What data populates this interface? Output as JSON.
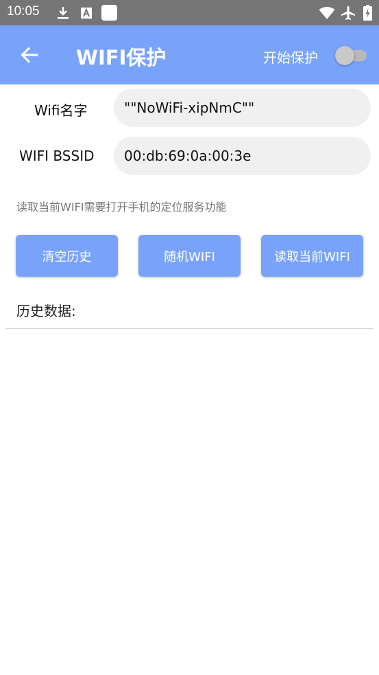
{
  "status_bar": {
    "time": "10:05",
    "left_icons": [
      "download-icon",
      "font-icon",
      "notification-square-icon"
    ],
    "right_icons": [
      "wifi-icon",
      "airplane-icon",
      "battery-charging-icon"
    ]
  },
  "app_bar": {
    "title": "WIFI保护",
    "protect_toggle_label": "开始保护",
    "protect_enabled": false,
    "background_color": "#79a3fb"
  },
  "form": {
    "wifi_name_label": "Wifi名字",
    "wifi_name_value": "\"\"NoWiFi-xipNmC\"\"",
    "bssid_label": "WIFI BSSID",
    "bssid_value": "00:db:69:0a:00:3e"
  },
  "hint": "读取当前WIFI需要打开手机的定位服务功能",
  "buttons": {
    "clear_history": "清空历史",
    "random_wifi": "随机WIFI",
    "read_current_wifi": "读取当前WIFI"
  },
  "history": {
    "label": "历史数据:",
    "items": []
  }
}
